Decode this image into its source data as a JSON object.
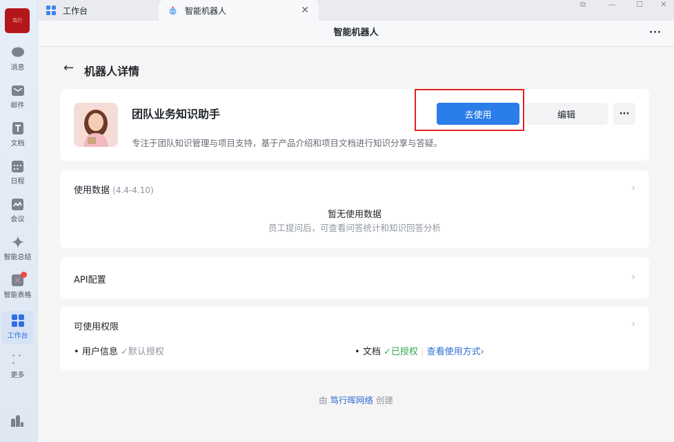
{
  "sidebar": {
    "logo_text": "笃行",
    "items": [
      {
        "label": "消息"
      },
      {
        "label": "邮件"
      },
      {
        "label": "文档"
      },
      {
        "label": "日程"
      },
      {
        "label": "会议"
      },
      {
        "label": "智能总结"
      },
      {
        "label": "智能表格"
      },
      {
        "label": "工作台"
      },
      {
        "label": "更多"
      }
    ]
  },
  "tabs": [
    {
      "label": "工作台"
    },
    {
      "label": "智能机器人"
    }
  ],
  "header": {
    "title": "智能机器人",
    "more": "···"
  },
  "page": {
    "title": "机器人详情"
  },
  "bot": {
    "name": "团队业务知识助手",
    "description": "专注于团队知识管理与项目支持，基于产品介绍和项目文档进行知识分享与答疑。",
    "use_label": "去使用",
    "edit_label": "编辑",
    "more": "···"
  },
  "usage": {
    "title": "使用数据",
    "range": "(4.4-4.10)",
    "empty_title": "暂无使用数据",
    "empty_desc": "员工提问后，可查看问答统计和知识回答分析"
  },
  "api": {
    "title": "API配置"
  },
  "permissions": {
    "title": "可使用权限",
    "items": [
      {
        "name": "用户信息",
        "status": "默认授权"
      },
      {
        "name": "文档",
        "status": "已授权",
        "link": "查看使用方式"
      }
    ]
  },
  "footer": {
    "prefix": "由",
    "creator": "笃行晖网络",
    "suffix": "创建"
  },
  "colors": {
    "primary": "#2b7de9",
    "success": "#34a853",
    "highlight": "#e02020"
  }
}
